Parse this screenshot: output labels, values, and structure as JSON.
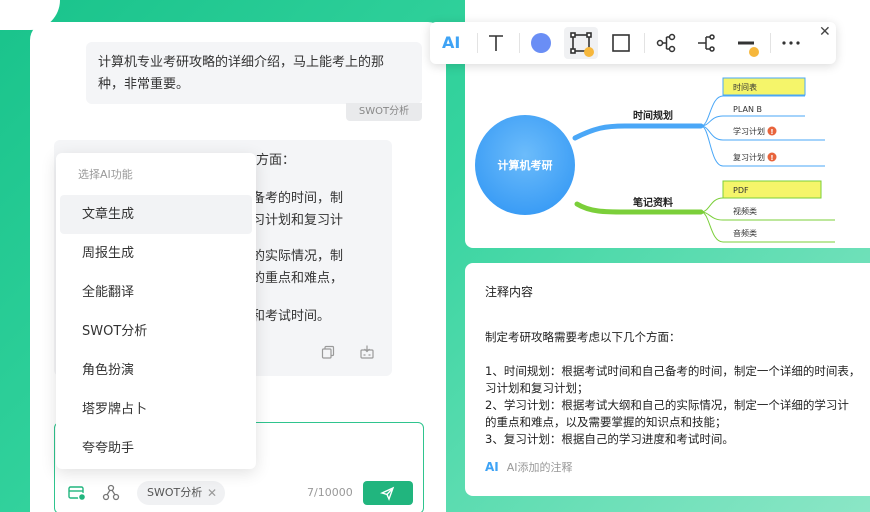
{
  "chat": {
    "user_message": "计算机专业考研攻略的详细介绍，马上能考上的那种，非常重要。",
    "user_message_line1": "计算机专业考研攻略的详细介绍，马上能考上的那",
    "user_message_line2": "种，非常重要。",
    "tag": "SWOT分析",
    "ai_lines": [
      "方面：",
      "自己备考的时间，制",
      "的学习计划和复习计",
      "自己的实际情况，制",
      "个科的重点和难点，",
      "进度和考试时间。"
    ]
  },
  "dropdown": {
    "header": "选择AI功能",
    "items": [
      "文章生成",
      "周报生成",
      "全能翻译",
      "SWOT分析",
      "角色扮演",
      "塔罗牌占卜",
      "夸夸助手"
    ],
    "selected_index": 0
  },
  "input": {
    "chip_label": "SWOT分析",
    "counter": "7/10000"
  },
  "toolbar": {
    "ai_label": "AI",
    "circle_color": "#6a8ef5"
  },
  "mindmap": {
    "root": "计算机考研",
    "branches": [
      {
        "label": "时间规划",
        "children": [
          "时间表",
          "PLAN B",
          "学习计划",
          "复习计划"
        ]
      },
      {
        "label": "笔记资料",
        "children": [
          "PDF",
          "视频类",
          "音频类"
        ]
      }
    ]
  },
  "note": {
    "title": "注释内容",
    "intro": "制定考研攻略需要考虑以下几个方面：",
    "lines": [
      "1、时间规划：根据考试时间和自己备考的时间，制定一个详细的时间表，",
      "习计划和复习计划；",
      "2、学习计划：根据考试大纲和自己的实际情况，制定一个详细的学习计",
      "的重点和难点，以及需要掌握的知识点和技能；",
      "3、复习计划：根据自己的学习进度和考试时间。"
    ],
    "footer_ai": "AI",
    "footer_text": "AI添加的注释"
  },
  "colors": {
    "accent_green": "#21b57e",
    "ai_blue": "#3ea3f5",
    "mindmap_blue": "#4aa7f7",
    "mindmap_green": "#7bcf3a",
    "highlight_yellow": "#f5f56a",
    "warning_orange": "#e8643c"
  }
}
